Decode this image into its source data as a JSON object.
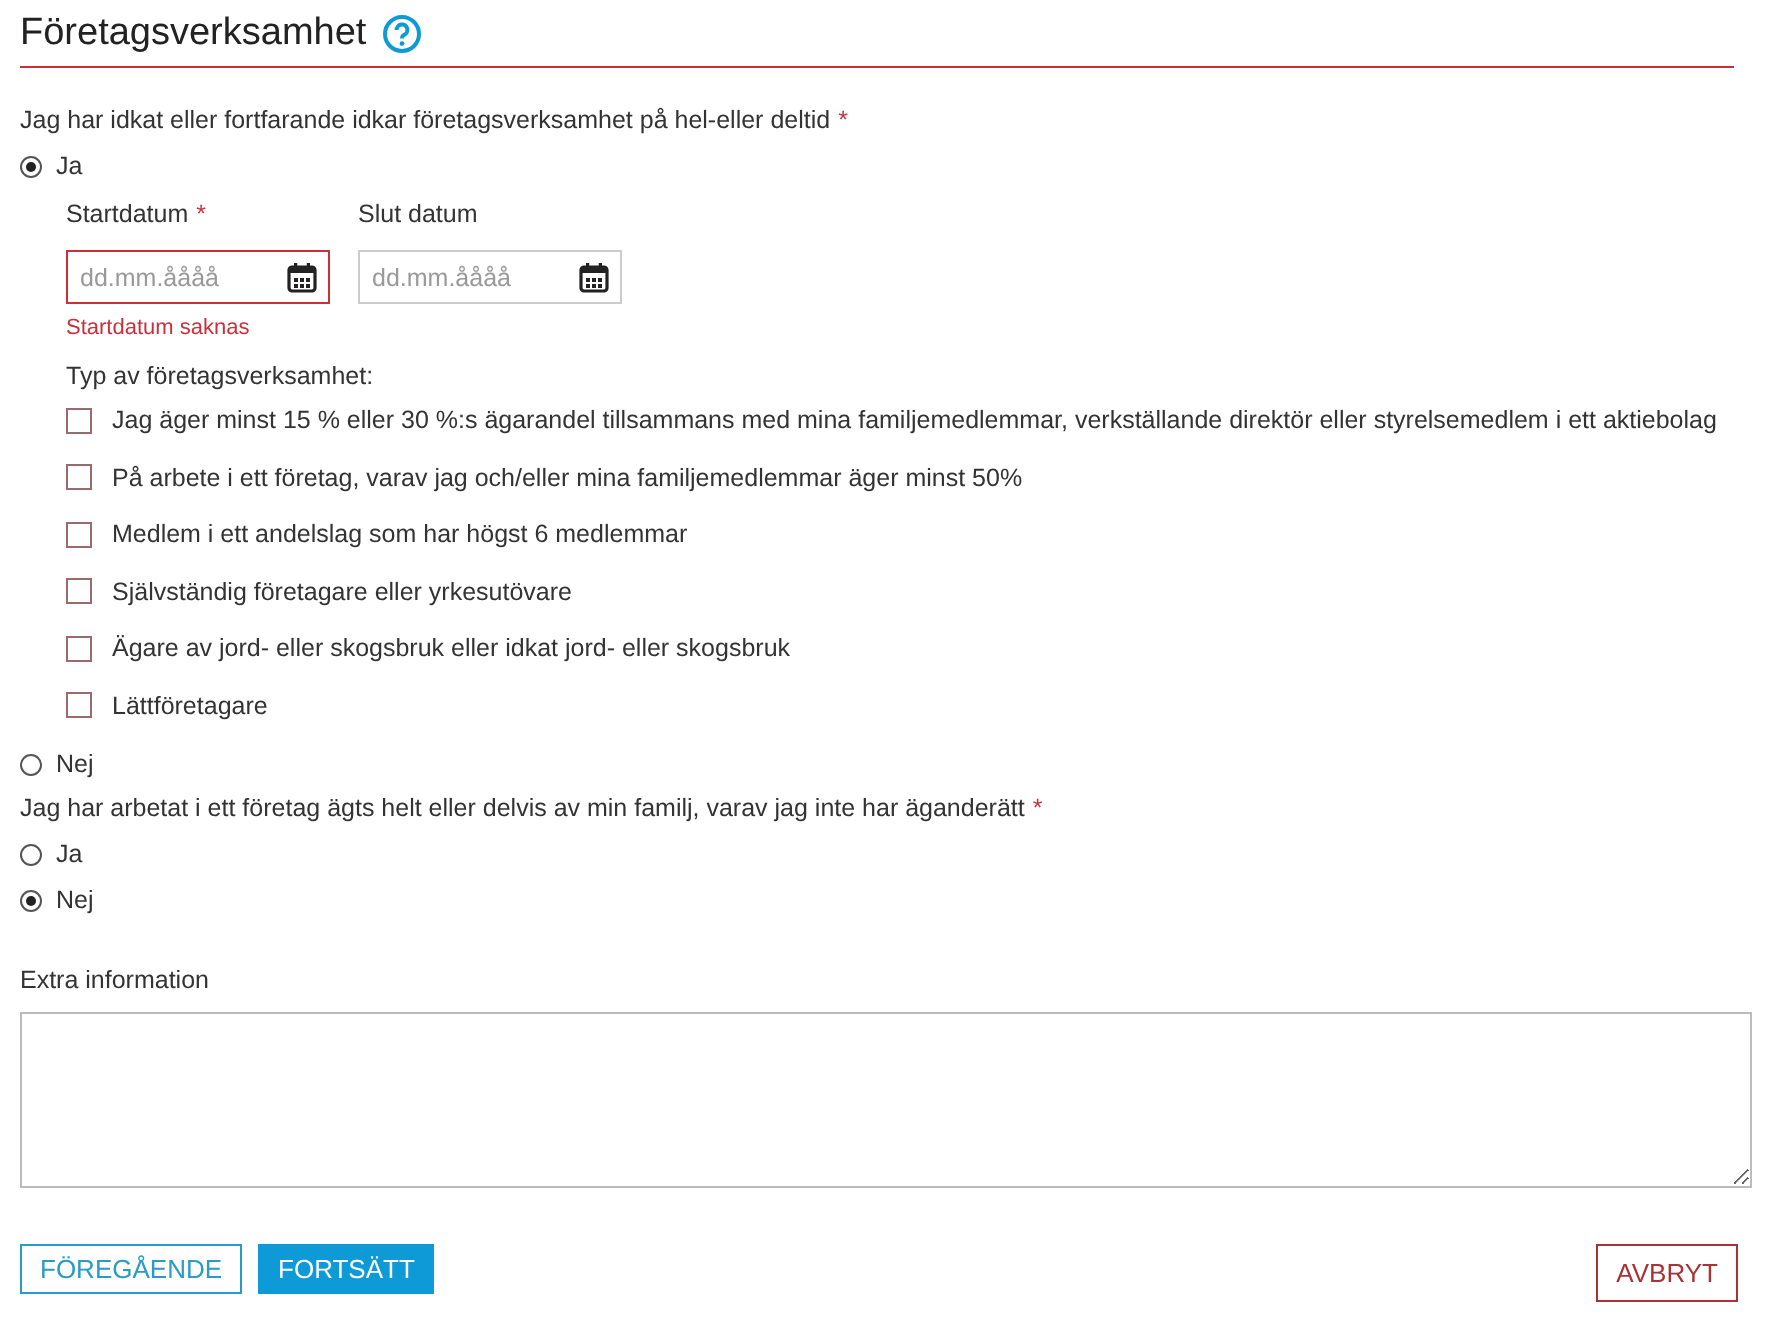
{
  "title": "Företagsverksamhet",
  "questions": [
    {
      "label": "Jag har idkat eller fortfarande idkar företagsverksamhet på hel-eller deltid",
      "required_mark": "*",
      "options": [
        {
          "label": "Ja",
          "selected": true,
          "details": {
            "dates": [
              {
                "label": "Startdatum",
                "required_mark": "*",
                "placeholder": "dd.mm.åååå",
                "error": "Startdatum saknas"
              },
              {
                "label": "Slut datum",
                "placeholder": "dd.mm.åååå"
              }
            ],
            "type_label": "Typ av företagsverksamhet:",
            "types": [
              {
                "label": "Jag äger minst 15 % eller 30 %:s ägarandel tillsammans med mina familjemedlemmar, verkställande direktör eller styrelsemedlem i ett aktiebolag",
                "checked": false
              },
              {
                "label": "På arbete i ett företag, varav jag och/eller mina familjemedlemmar äger minst 50%",
                "checked": false
              },
              {
                "label": "Medlem i ett andelslag som har högst 6 medlemmar",
                "checked": false
              },
              {
                "label": "Självständig företagare eller yrkesutövare",
                "checked": false
              },
              {
                "label": "Ägare av jord- eller skogsbruk eller idkat jord- eller skogsbruk",
                "checked": false
              },
              {
                "label": "Lättföretagare",
                "checked": false
              }
            ]
          }
        },
        {
          "label": "Nej",
          "selected": false
        }
      ]
    },
    {
      "label": "Jag har arbetat i ett företag ägts helt eller delvis av min familj, varav jag inte har äganderätt",
      "required_mark": "*",
      "options": [
        {
          "label": "Ja",
          "selected": false
        },
        {
          "label": "Nej",
          "selected": true
        }
      ]
    }
  ],
  "extra": {
    "label": "Extra information"
  },
  "buttons": [
    {
      "label": "FÖREGÅENDE",
      "kind": "secondary"
    },
    {
      "label": "FORTSÄTT",
      "kind": "primary"
    },
    {
      "label": "AVBRYT",
      "kind": "cancel"
    }
  ]
}
